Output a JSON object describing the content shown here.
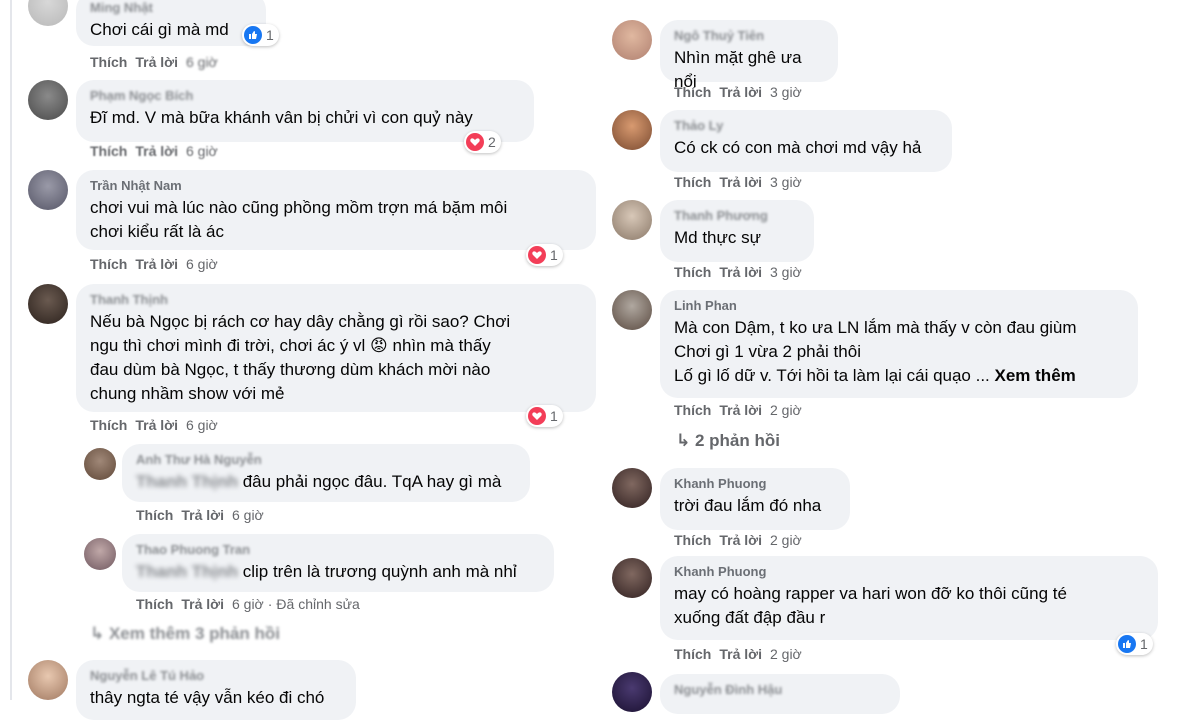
{
  "labels": {
    "like": "Thích",
    "reply": "Trả lời",
    "edited": "Đã chỉnh sửa",
    "see_more": "Xem thêm"
  },
  "left": [
    {
      "author": "Ming Nhật",
      "text": "Chơi cái gì mà md",
      "time": "6 giờ",
      "reactions": "1",
      "reaction_type": "like"
    },
    {
      "author": "Phạm Ngọc Bích",
      "text": "Đĩ md. V mà bữa khánh vân bị chửi vì con quỷ này",
      "time": "6 giờ",
      "reactions": "2",
      "reaction_type": "heart"
    },
    {
      "author": "Trần Nhật Nam",
      "text": "chơi vui mà lúc nào cũng phồng mồm trợn má bặm môi\nchơi kiểu rất là ác",
      "time": "6 giờ",
      "reactions": "1",
      "reaction_type": "heart"
    },
    {
      "author": "Thanh Thịnh",
      "text": "Nếu bà Ngọc bị rách cơ hay dây chằng gì rồi sao? Chơi\nngu thì chơi mình đi trời, chơi ác ý vl 😡 nhìn mà thấy\nđau dùm bà Ngọc, t thấy thương dùm khách mời nào\nchung nhầm show với mẻ",
      "time": "6 giờ",
      "reactions": "1",
      "reaction_type": "heart"
    },
    {
      "author": "Anh Thư Hà Nguyễn",
      "tag": "Thanh Thịnh",
      "text": "đâu phải ngọc đâu. TqA hay gì mà",
      "time": "6 giờ"
    },
    {
      "author": "Thao Phuong Tran",
      "tag": "Thanh Thịnh",
      "text": "clip trên là trương quỳnh anh mà nhỉ",
      "time": "6 giờ"
    },
    {
      "more_replies": "Xem thêm 3 phản hồi"
    },
    {
      "author": "Nguyễn Lê Tú Hảo",
      "text": "thây ngta té vậy vẫn kéo đi chó"
    }
  ],
  "right": [
    {
      "author": "Ngô Thuỷ Tiên",
      "text": "Nhìn mặt ghê ưa nổi",
      "time": "3 giờ"
    },
    {
      "author": "Thảo Ly",
      "text": "Có ck có con mà chơi md vậy hả",
      "time": "3 giờ"
    },
    {
      "author": "Thanh Phương",
      "text": "Md thực sự",
      "time": "3 giờ"
    },
    {
      "author": "Linh Phan",
      "text": "Mà con Dậm, t ko ưa LN lắm mà thấy v còn đau giùm\nChơi gì 1 vừa 2 phải thôi\nLố gì lố dữ v. Tới hồi ta làm lại cái quạo ...",
      "see_more": "Xem thêm",
      "time": "2 giờ",
      "replies": "2 phản hồi"
    },
    {
      "author": "Khanh Phuong",
      "text": "trời đau lắm đó nha",
      "time": "2 giờ"
    },
    {
      "author": "Khanh Phuong",
      "text": "may có hoàng rapper va hari won đỡ ko thôi cũng té\nxuống đất đập đầu r",
      "time": "2 giờ",
      "reactions": "1",
      "reaction_type": "like"
    },
    {
      "author": "Nguyễn Đình Hậu"
    }
  ],
  "colors": {
    "bubble": "#f0f2f5",
    "like": "#1877f2",
    "heart": "#f33e58",
    "meta": "#65676b"
  }
}
